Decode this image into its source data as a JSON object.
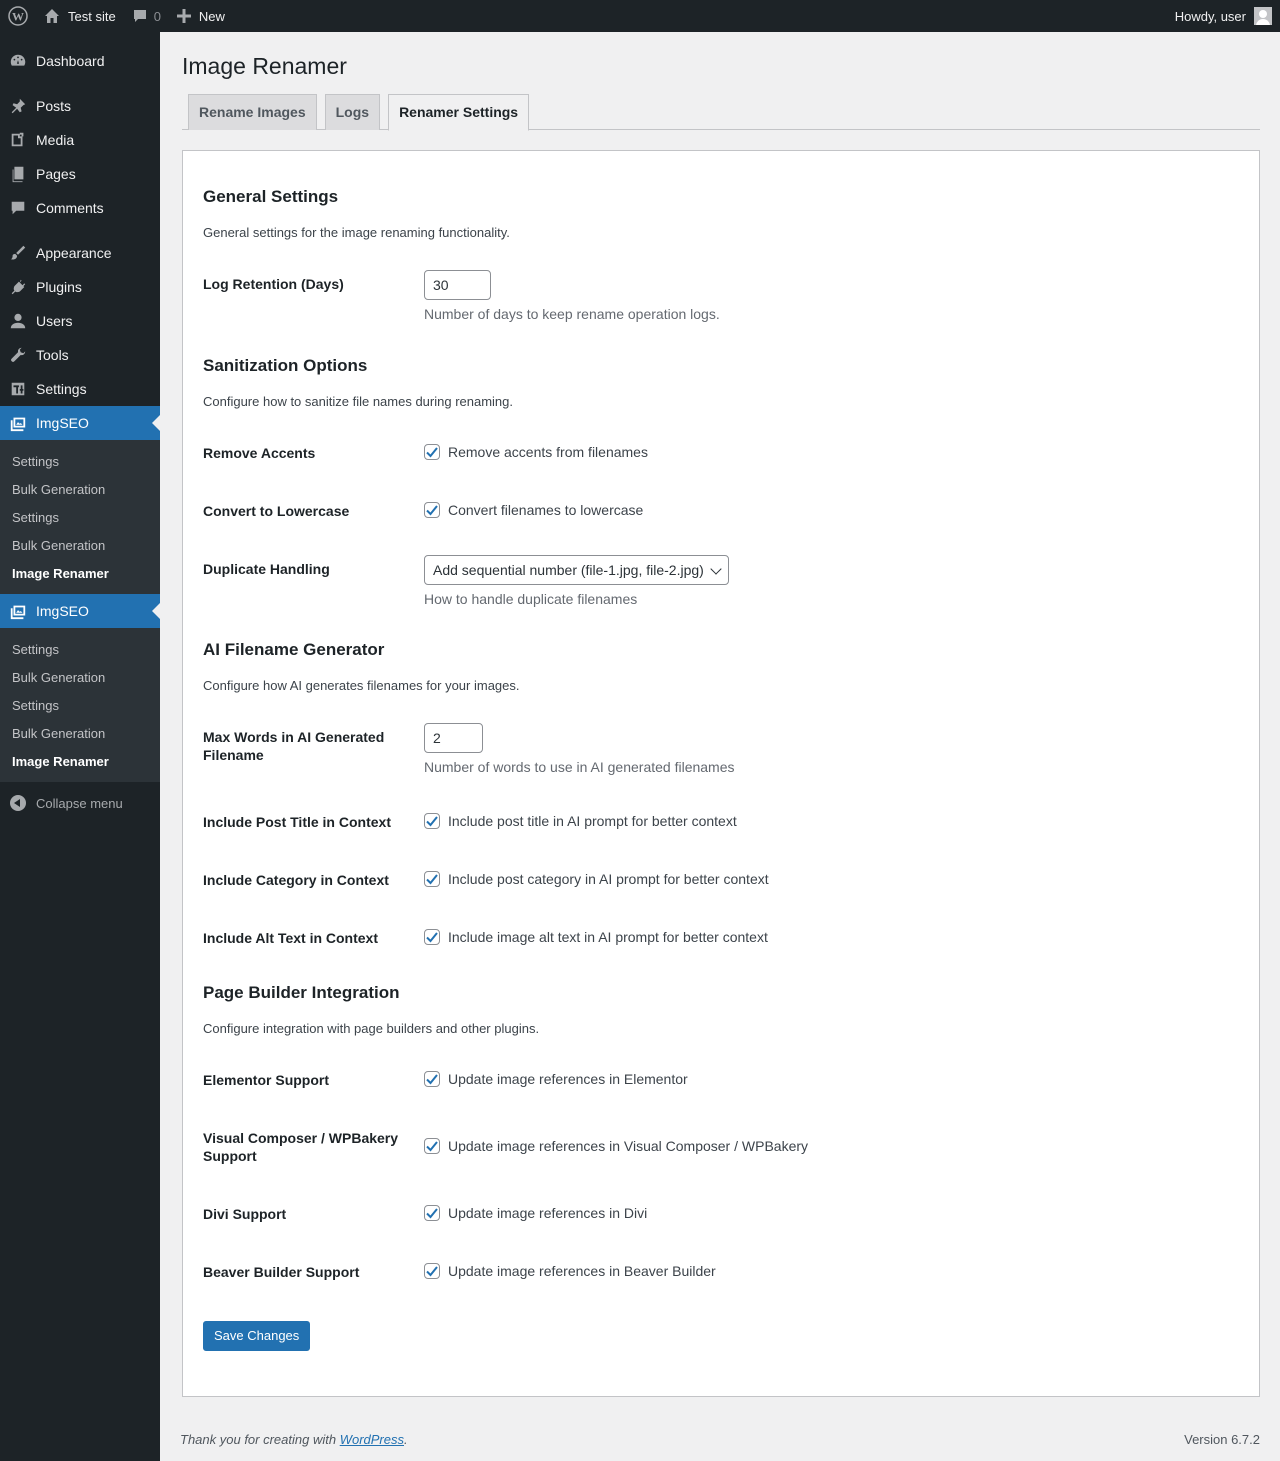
{
  "adminbar": {
    "site_name": "Test site",
    "comments_count": "0",
    "new_label": "New",
    "howdy": "Howdy, user"
  },
  "sidebar": {
    "items": [
      {
        "label": "Dashboard",
        "icon": "dashboard-icon"
      },
      {
        "label": "Posts",
        "icon": "pin-icon"
      },
      {
        "label": "Media",
        "icon": "media-icon"
      },
      {
        "label": "Pages",
        "icon": "pages-icon"
      },
      {
        "label": "Comments",
        "icon": "comment-icon"
      },
      {
        "label": "Appearance",
        "icon": "brush-icon"
      },
      {
        "label": "Plugins",
        "icon": "plug-icon"
      },
      {
        "label": "Users",
        "icon": "user-icon"
      },
      {
        "label": "Tools",
        "icon": "wrench-icon"
      },
      {
        "label": "Settings",
        "icon": "settings-icon"
      }
    ],
    "imgseo_1": {
      "label": "ImgSEO",
      "sub": [
        "Settings",
        "Bulk Generation",
        "Settings",
        "Bulk Generation",
        "Image Renamer"
      ]
    },
    "imgseo_2": {
      "label": "ImgSEO",
      "sub": [
        "Settings",
        "Bulk Generation",
        "Settings",
        "Bulk Generation",
        "Image Renamer"
      ]
    },
    "collapse_label": "Collapse menu"
  },
  "page": {
    "title": "Image Renamer",
    "tabs": [
      "Rename Images",
      "Logs",
      "Renamer Settings"
    ]
  },
  "general": {
    "heading": "General Settings",
    "description": "General settings for the image renaming functionality.",
    "log_retention_label": "Log Retention (Days)",
    "log_retention_value": "30",
    "log_retention_desc": "Number of days to keep rename operation logs."
  },
  "sanitization": {
    "heading": "Sanitization Options",
    "description": "Configure how to sanitize file names during renaming.",
    "remove_accents_label": "Remove Accents",
    "remove_accents_text": "Remove accents from filenames",
    "lowercase_label": "Convert to Lowercase",
    "lowercase_text": "Convert filenames to lowercase",
    "duplicate_label": "Duplicate Handling",
    "duplicate_value": "Add sequential number (file-1.jpg, file-2.jpg)",
    "duplicate_desc": "How to handle duplicate filenames"
  },
  "ai": {
    "heading": "AI Filename Generator",
    "description": "Configure how AI generates filenames for your images.",
    "max_words_label": "Max Words in AI Generated Filename",
    "max_words_value": "2",
    "max_words_desc": "Number of words to use in AI generated filenames",
    "post_title_label": "Include Post Title in Context",
    "post_title_text": "Include post title in AI prompt for better context",
    "category_label": "Include Category in Context",
    "category_text": "Include post category in AI prompt for better context",
    "alt_label": "Include Alt Text in Context",
    "alt_text": "Include image alt text in AI prompt for better context"
  },
  "builder": {
    "heading": "Page Builder Integration",
    "description": "Configure integration with page builders and other plugins.",
    "elementor_label": "Elementor Support",
    "elementor_text": "Update image references in Elementor",
    "wpbakery_label": "Visual Composer / WPBakery Support",
    "wpbakery_text": "Update image references in Visual Composer / WPBakery",
    "divi_label": "Divi Support",
    "divi_text": "Update image references in Divi",
    "beaver_label": "Beaver Builder Support",
    "beaver_text": "Update image references in Beaver Builder"
  },
  "save_label": "Save Changes",
  "footer": {
    "thanks_prefix": "Thank you for creating with ",
    "thanks_link": "WordPress",
    "thanks_suffix": ".",
    "version": "Version 6.7.2"
  },
  "colors": {
    "accent": "#2271b1",
    "adminbar_bg": "#1d2327",
    "background": "#f0f0f1"
  }
}
